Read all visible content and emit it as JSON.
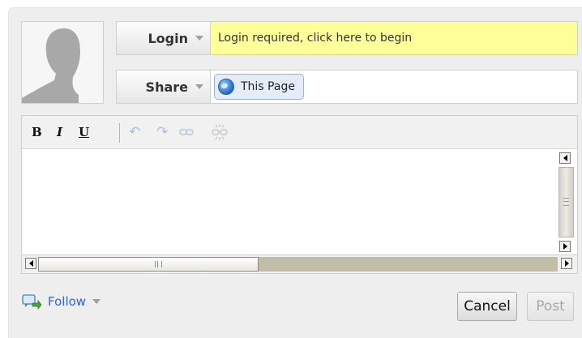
{
  "header": {
    "login": {
      "label": "Login",
      "message": "Login required, click here to begin"
    },
    "share": {
      "label": "Share",
      "target": "This Page"
    }
  },
  "editor": {
    "toolbar": {
      "bold": "B",
      "italic": "I",
      "underline": "U",
      "undo": "↶",
      "redo": "↷"
    },
    "text": ""
  },
  "footer": {
    "follow_label": "Follow",
    "cancel_label": "Cancel",
    "post_label": "Post"
  },
  "colors": {
    "login_bg": "#ffff99",
    "link": "#3366cc",
    "chip_bg": "#e3ecf8"
  },
  "icons": [
    "avatar-silhouette",
    "dropdown-arrow-icon",
    "globe-icon",
    "undo-icon",
    "redo-icon",
    "link-icon",
    "unlink-icon",
    "follow-icon"
  ]
}
